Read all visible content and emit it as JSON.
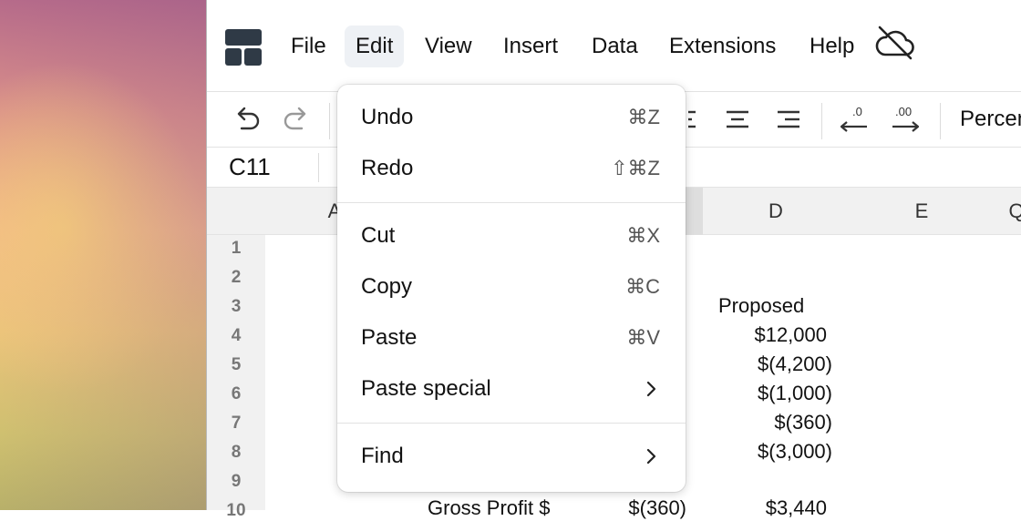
{
  "menubar": {
    "items": [
      "File",
      "Edit",
      "View",
      "Insert",
      "Data",
      "Extensions",
      "Help"
    ],
    "active": "Edit"
  },
  "toolbar": {
    "format_label": "Percen"
  },
  "formula_bar": {
    "cell_ref": "C11"
  },
  "columns": [
    "A",
    "D",
    "E",
    "Q"
  ],
  "rows": [
    "1",
    "2",
    "3",
    "4",
    "5",
    "6",
    "7",
    "8",
    "9",
    "10"
  ],
  "cells": {
    "d3": "Proposed",
    "d4": "$12,000",
    "d5": "$(4,200)",
    "d6": "$(1,000)",
    "d7": "$(360)",
    "d8": "$(3,000)",
    "b10": "Gross Profit $",
    "c10": "$(360)",
    "d10": "$3,440"
  },
  "edit_menu": {
    "undo": {
      "label": "Undo",
      "shortcut": "⌘Z"
    },
    "redo": {
      "label": "Redo",
      "shortcut": "⇧⌘Z"
    },
    "cut": {
      "label": "Cut",
      "shortcut": "⌘X"
    },
    "copy": {
      "label": "Copy",
      "shortcut": "⌘C"
    },
    "paste": {
      "label": "Paste",
      "shortcut": "⌘V"
    },
    "paste_special": {
      "label": "Paste special"
    },
    "find": {
      "label": "Find"
    }
  }
}
